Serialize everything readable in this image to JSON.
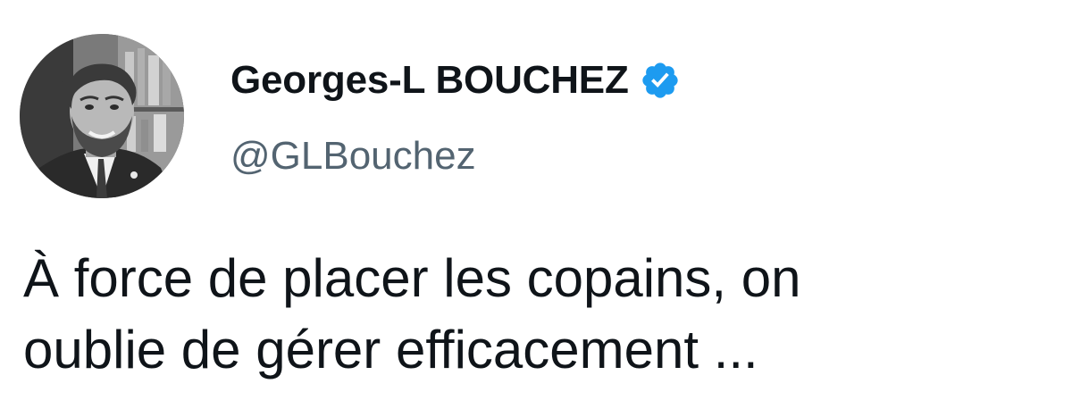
{
  "author": {
    "display_name": "Georges-L BOUCHEZ",
    "handle": "@GLBouchez",
    "verified": true,
    "verified_icon": "verified-badge-icon",
    "verified_color": "#1d9bf0"
  },
  "tweet": {
    "lines": [
      "À force de placer les copains, on",
      "oublie de gérer efficacement ..."
    ]
  },
  "colors": {
    "text_primary": "#0f1419",
    "text_secondary": "#536471",
    "background": "#ffffff"
  }
}
